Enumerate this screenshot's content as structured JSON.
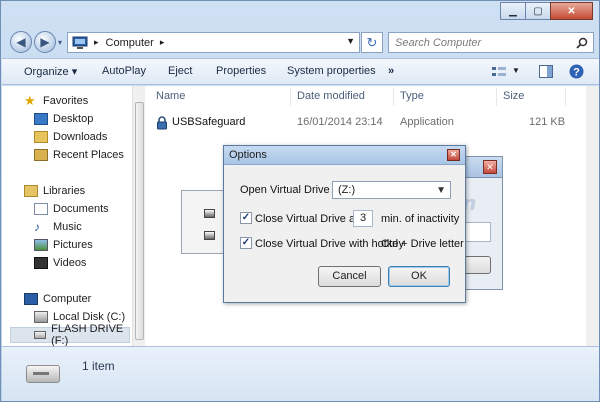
{
  "address": {
    "crumbs": [
      "Computer"
    ]
  },
  "search": {
    "placeholder": "Search Computer"
  },
  "toolbar": {
    "organize": "Organize",
    "autoplay": "AutoPlay",
    "eject": "Eject",
    "properties": "Properties",
    "system_properties": "System properties",
    "more": "»"
  },
  "sidebar": {
    "favorites": {
      "header": "Favorites",
      "items": [
        "Desktop",
        "Downloads",
        "Recent Places"
      ]
    },
    "libraries": {
      "header": "Libraries",
      "items": [
        "Documents",
        "Music",
        "Pictures",
        "Videos"
      ]
    },
    "computer": {
      "header": "Computer",
      "items": [
        "Local Disk (C:)",
        "FLASH DRIVE (F:)"
      ]
    }
  },
  "columns": [
    "Name",
    "Date modified",
    "Type",
    "Size"
  ],
  "files": [
    {
      "name": "USBSafeguard",
      "date": "16/01/2014 23:14",
      "type": "Application",
      "size": "121 KB"
    }
  ],
  "status": {
    "count": "1 item"
  },
  "options_dialog": {
    "title": "Options",
    "open_label": "Open Virtual Drive as",
    "drive_value": "(Z:)",
    "close_after_label": "Close Virtual Drive after",
    "minutes_value": "3",
    "minutes_suffix": "min. of inactivity",
    "close_after_checked": true,
    "hotkey_label": "Close Virtual Drive with hotkey",
    "hotkey_value": "Ctrl + Drive letter",
    "hotkey_checked": true,
    "cancel": "Cancel",
    "ok": "OK"
  },
  "colors": {
    "accent": "#3c7fb1",
    "titlebar": "#a8c5e7",
    "close": "#c4483a"
  },
  "icons": {
    "caption": [
      "minimize-icon",
      "maximize-icon",
      "close-icon"
    ],
    "nav": [
      "back-icon",
      "forward-icon",
      "refresh-icon",
      "search-icon",
      "help-icon"
    ]
  }
}
